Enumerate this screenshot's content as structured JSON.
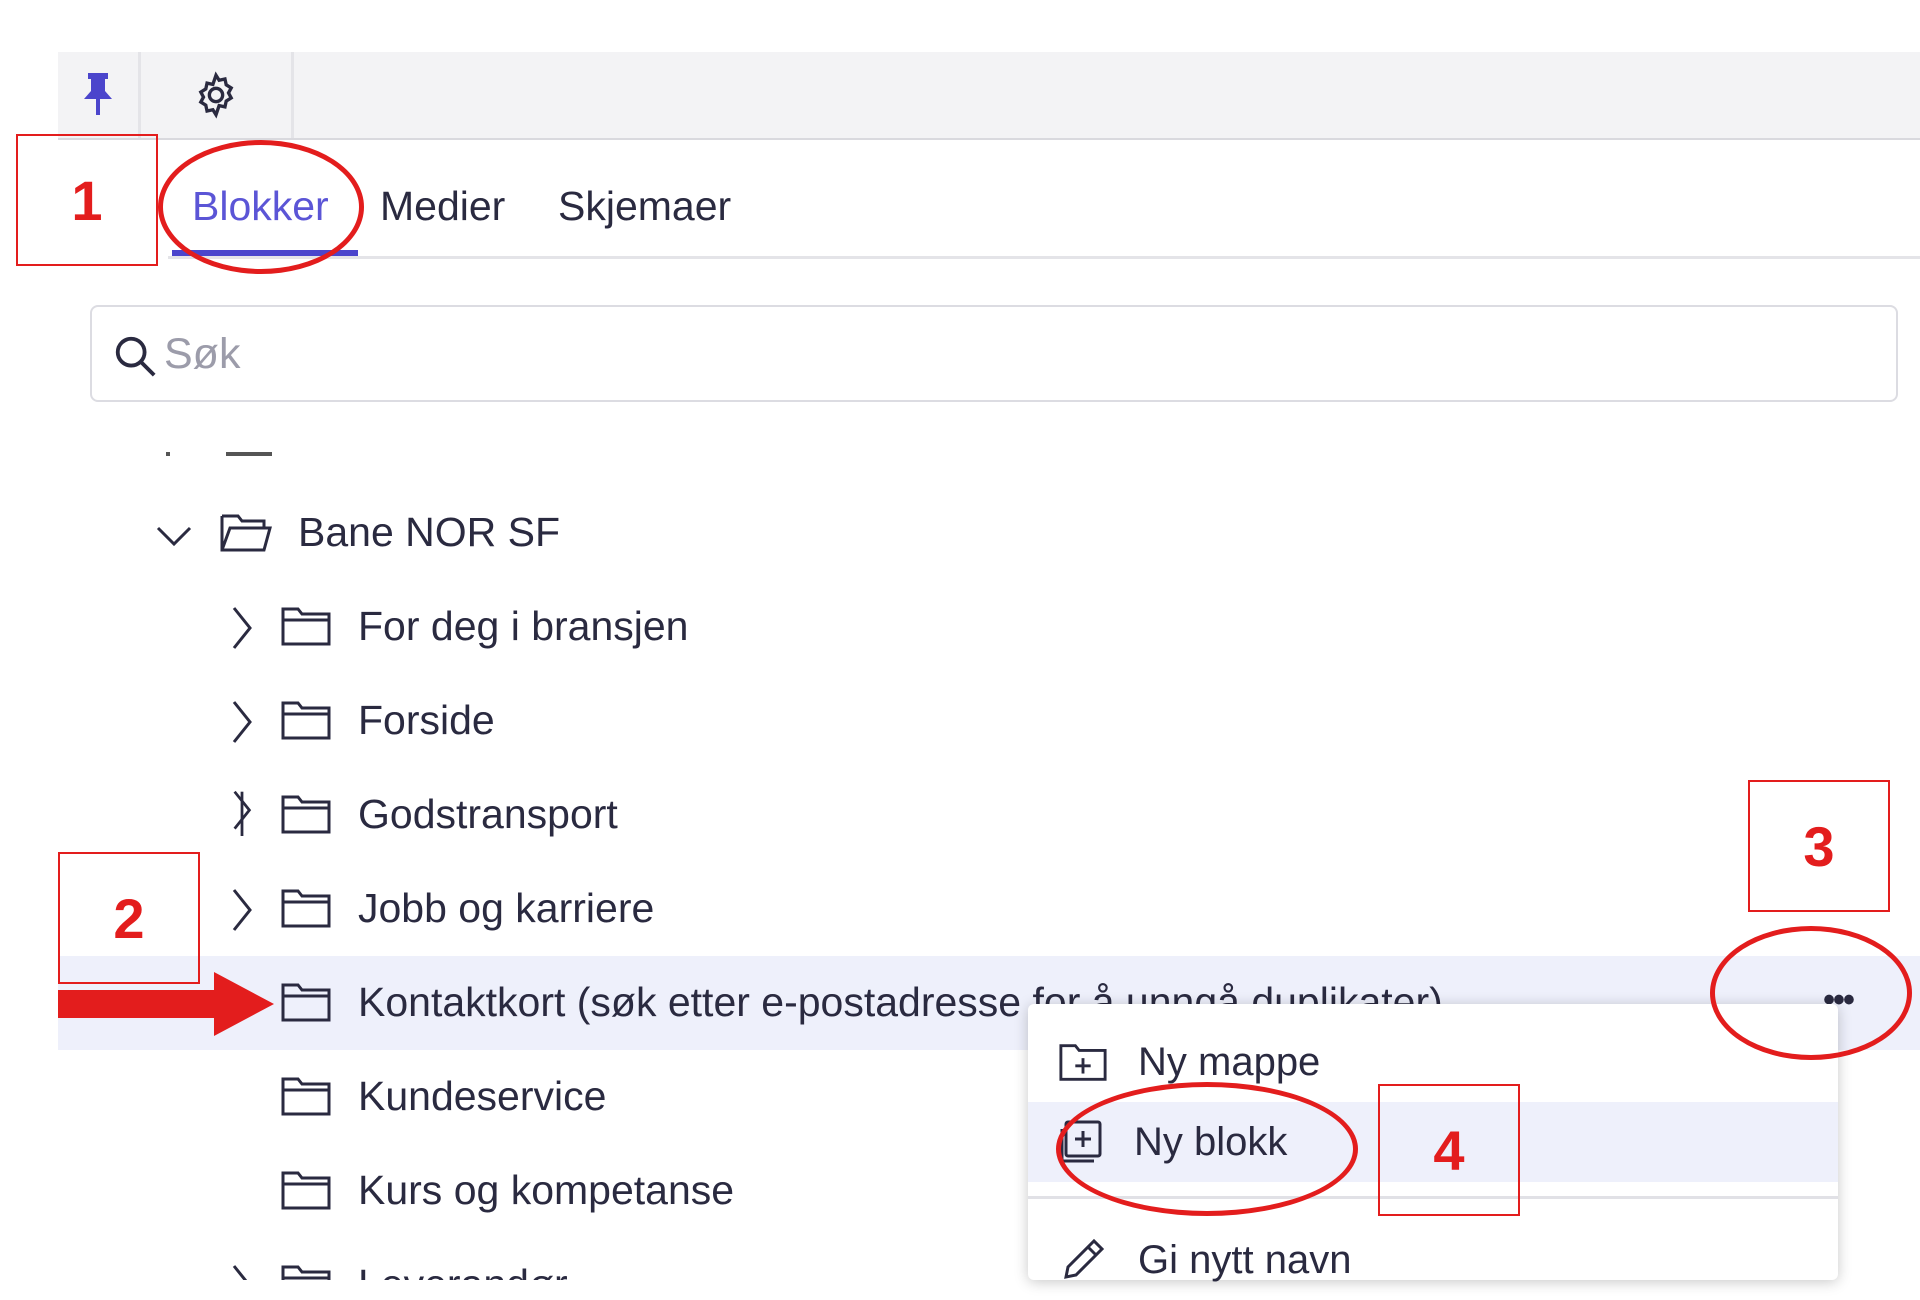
{
  "toolbar": {
    "pin_icon": "pin-icon",
    "settings_icon": "gear-icon"
  },
  "tabs": [
    {
      "label": "Blokker",
      "active": true
    },
    {
      "label": "Medier",
      "active": false
    },
    {
      "label": "Skjemaer",
      "active": false
    }
  ],
  "search": {
    "placeholder": "Søk",
    "value": ""
  },
  "tree": {
    "root": {
      "label": "Bane NOR SF",
      "expanded": true
    },
    "items": [
      {
        "label": "For deg i bransjen"
      },
      {
        "label": "Forside"
      },
      {
        "label": "Godstransport"
      },
      {
        "label": "Jobb og karriere"
      },
      {
        "label": "Kontaktkort (søk etter e-postadresse for å unngå duplikater)",
        "selected": true
      },
      {
        "label": "Kundeservice"
      },
      {
        "label": "Kurs og kompetanse"
      },
      {
        "label": "Leverandør"
      }
    ],
    "more_button": "•••"
  },
  "context_menu": {
    "items": [
      {
        "label": "Ny mappe",
        "icon": "folder-plus-icon"
      },
      {
        "label": "Ny blokk",
        "icon": "block-plus-icon"
      },
      {
        "label": "Gi nytt navn",
        "icon": "pencil-icon"
      }
    ]
  },
  "annotations": {
    "step1": "1",
    "step2": "2",
    "step3": "3",
    "step4": "4",
    "color": "#e31d1d"
  },
  "colors": {
    "accent": "#5b55d6",
    "selected_row": "#eef0fb",
    "text": "#2a2a40"
  }
}
